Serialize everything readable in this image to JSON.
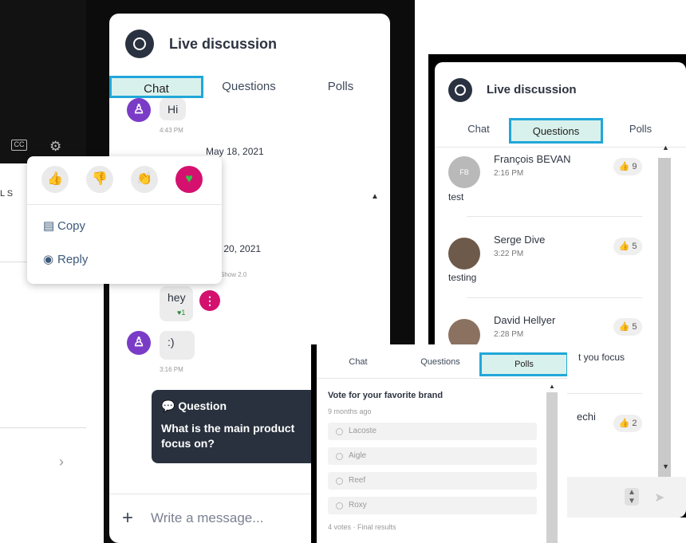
{
  "main_panel": {
    "title": "Live discussion",
    "tabs": [
      "Chat",
      "Questions",
      "Polls"
    ],
    "active_tab": "Chat",
    "messages": [
      {
        "text": "Hi",
        "time": "4:43 PM"
      },
      {
        "date": "May 18, 2021"
      },
      {
        "date_partial": "y 20, 2021"
      },
      {
        "sender_partial": "Show 2.0"
      },
      {
        "text": "hey",
        "reaction_count": "1"
      },
      {
        "text": ":)",
        "time": "3:16 PM"
      }
    ],
    "question_card": {
      "label": "Question",
      "text_line1": "What is the main product",
      "text_line2": "focus on?"
    },
    "composer_placeholder": "Write a message..."
  },
  "reaction_popup": {
    "reactions": [
      "thumbs-up",
      "thumbs-down",
      "clap",
      "heart"
    ],
    "menu": [
      {
        "label": "Copy"
      },
      {
        "label": "Reply"
      }
    ]
  },
  "questions_panel": {
    "title": "Live discussion",
    "tabs": [
      "Chat",
      "Questions",
      "Polls"
    ],
    "active_tab": "Questions",
    "items": [
      {
        "initials": "FB",
        "name": "François BEVAN",
        "time": "2:16 PM",
        "likes": "9",
        "body": "test"
      },
      {
        "name": "Serge Dive",
        "time": "3:22 PM",
        "likes": "5",
        "body": "testing"
      },
      {
        "name": "David Hellyer",
        "time": "2:28 PM",
        "likes": "5",
        "body": "t you focus"
      },
      {
        "name_partial": "echi",
        "likes": "2"
      }
    ]
  },
  "polls_panel": {
    "tabs": [
      "Chat",
      "Questions",
      "Polls"
    ],
    "active_tab": "Polls",
    "poll_title": "Vote for your favorite brand",
    "poll_age": "9 months ago",
    "options": [
      "Lacoste",
      "Aigle",
      "Reef",
      "Roxy"
    ],
    "footer": "4 votes · Final results"
  },
  "colors": {
    "accent_teal": "#d9f1ec",
    "highlight_blue": "#21a7d9",
    "dark_card": "#29313e",
    "purple_avatar": "#7a3cc7",
    "magenta": "#d4116f"
  },
  "left_sidebar": {
    "partial_label": "L S"
  }
}
